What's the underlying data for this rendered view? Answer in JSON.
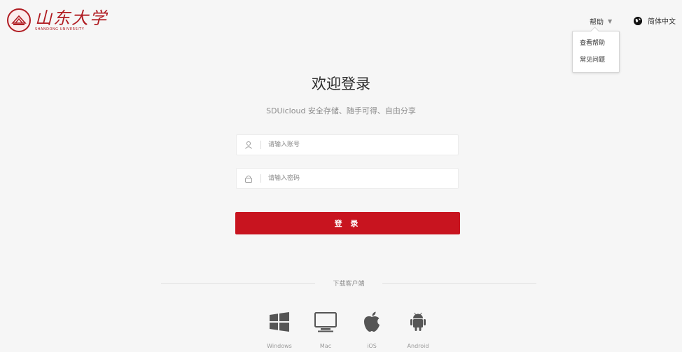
{
  "header": {
    "logo": {
      "cn_text": "山东大学",
      "en_text": "SHANDONG UNIVERSITY"
    },
    "help_label": "帮助",
    "language_label": "简体中文",
    "help_menu": [
      {
        "label": "查看帮助"
      },
      {
        "label": "常见问题"
      }
    ]
  },
  "login": {
    "title": "欢迎登录",
    "subtitle": "SDUicloud 安全存储、随手可得、自由分享",
    "account": {
      "placeholder": "请输入账号",
      "value": ""
    },
    "password": {
      "placeholder": "请输入密码",
      "value": ""
    },
    "submit_label": "登 录"
  },
  "download": {
    "label": "下载客户端",
    "platforms": [
      {
        "name": "Windows",
        "icon": "windows-icon"
      },
      {
        "name": "Mac",
        "icon": "monitor-icon"
      },
      {
        "name": "iOS",
        "icon": "apple-icon"
      },
      {
        "name": "Android",
        "icon": "android-icon"
      }
    ]
  },
  "colors": {
    "brand_red": "#c8141f",
    "logo_red": "#b01c22",
    "background": "#f6f6f6"
  }
}
